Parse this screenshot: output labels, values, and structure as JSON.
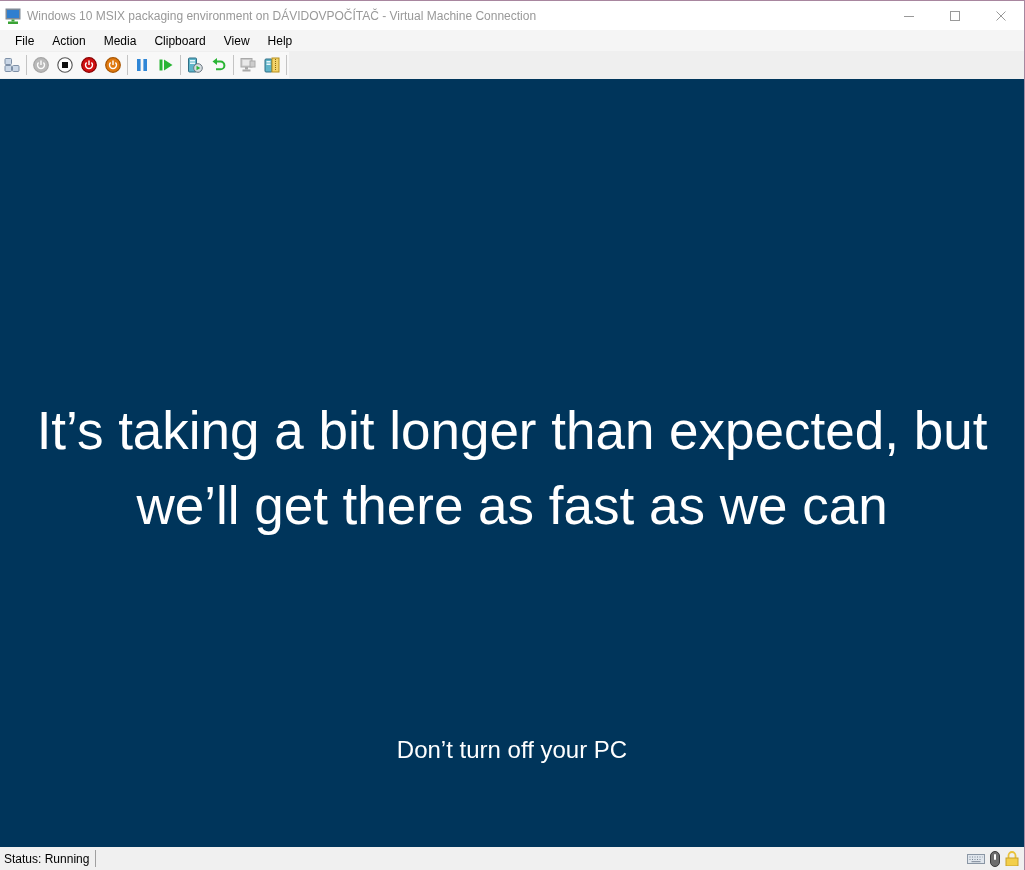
{
  "window": {
    "title": "Windows 10 MSIX packaging environment on DÁVIDOVPOČÍTAČ - Virtual Machine Connection",
    "active": false
  },
  "menu": [
    "File",
    "Action",
    "Media",
    "Clipboard",
    "View",
    "Help"
  ],
  "toolbar": {
    "groups": [
      [
        {
          "kind": "keys",
          "disabled": false
        }
      ],
      [
        {
          "kind": "start",
          "disabled": true
        },
        {
          "kind": "turnoff",
          "disabled": false
        },
        {
          "kind": "shutdown",
          "disabled": false
        },
        {
          "kind": "save",
          "disabled": false
        }
      ],
      [
        {
          "kind": "pause",
          "disabled": false
        },
        {
          "kind": "reset",
          "disabled": false
        }
      ],
      [
        {
          "kind": "checkpoint",
          "disabled": false
        },
        {
          "kind": "revert",
          "disabled": false
        }
      ],
      [
        {
          "kind": "session",
          "disabled": true
        },
        {
          "kind": "share",
          "disabled": false
        }
      ]
    ]
  },
  "screen": {
    "message": "It’s taking a bit longer than expected, but we’ll get there as fast as we can",
    "note": "Don’t turn off your PC"
  },
  "status_bar": {
    "status": "Status: Running"
  }
}
